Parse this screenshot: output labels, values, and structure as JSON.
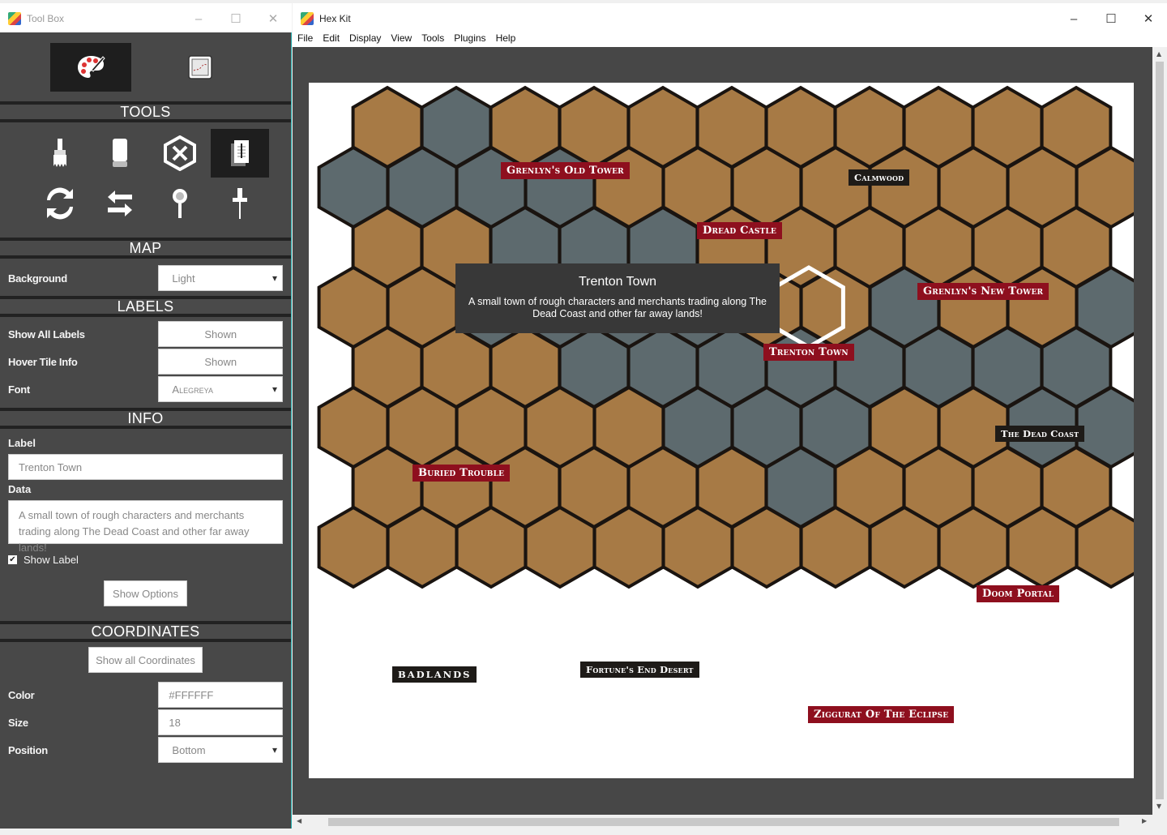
{
  "toolbox_window": {
    "title": "Tool Box"
  },
  "hexkit_window": {
    "title": "Hex Kit"
  },
  "window_controls": {
    "minimize": "–",
    "maximize": "☐",
    "close": "✕"
  },
  "menu": [
    "File",
    "Edit",
    "Display",
    "View",
    "Tools",
    "Plugins",
    "Help"
  ],
  "sections": {
    "tools": "TOOLS",
    "map": "MAP",
    "labels": "LABELS",
    "info": "INFO",
    "coordinates": "COORDINATES"
  },
  "map_settings": {
    "background_label": "Background",
    "background_value": "Light"
  },
  "labels_settings": {
    "show_all_labels": "Show All Labels",
    "show_all_labels_value": "Shown",
    "hover_tile_info": "Hover Tile Info",
    "hover_tile_info_value": "Shown",
    "font": "Font",
    "font_value": "Alegreya"
  },
  "info": {
    "label_title": "Label",
    "label_value": "Trenton Town",
    "data_title": "Data",
    "data_value": "A small town of rough characters and merchants trading along The Dead Coast and other far away lands!",
    "show_label": "Show Label",
    "show_options": "Show Options"
  },
  "coordinates": {
    "show_all": "Show all Coordinates",
    "color_label": "Color",
    "color_value": "#FFFFFF",
    "size_label": "Size",
    "size_value": "18",
    "position_label": "Position",
    "position_value": "Bottom"
  },
  "tooltip": {
    "title": "Trenton Town",
    "text": "A small town of rough characters and merchants trading along The Dead Coast and other far away lands!"
  },
  "map_labels": {
    "grenlyns_old_tower": "Grenlyn's Old Tower",
    "calmwood": "Calmwood",
    "dread_castle": "Dread Castle",
    "grenlyns_new_tower": "Grenlyn's New Tower",
    "trenton_town": "Trenton Town",
    "the_dead_coast": "The Dead Coast",
    "buried_trouble": "Buried Trouble",
    "doom_portal": "Doom Portal",
    "fortunes_end_desert": "Fortune's End Desert",
    "badlands": "BADLANDS",
    "ziggurat": "Ziggurat Of The Eclipse"
  },
  "icons": {
    "tabs": [
      "palette-icon",
      "map-frame-icon"
    ],
    "tools": [
      "brush-icon",
      "eraser-icon",
      "clear-hex-icon",
      "label-note-icon",
      "rotate-icon",
      "swap-icon",
      "magnifier-icon",
      "pin-icon"
    ]
  },
  "colors": {
    "panel_bg": "#484848",
    "section_border": "#222222",
    "label_red": "#8e0f1e",
    "label_dark": "#1e1b18",
    "canvas_bg": "#474747",
    "hex_land": "#a77a45",
    "hex_water": "#5d6a6e",
    "hex_outline": "#1a1410"
  }
}
